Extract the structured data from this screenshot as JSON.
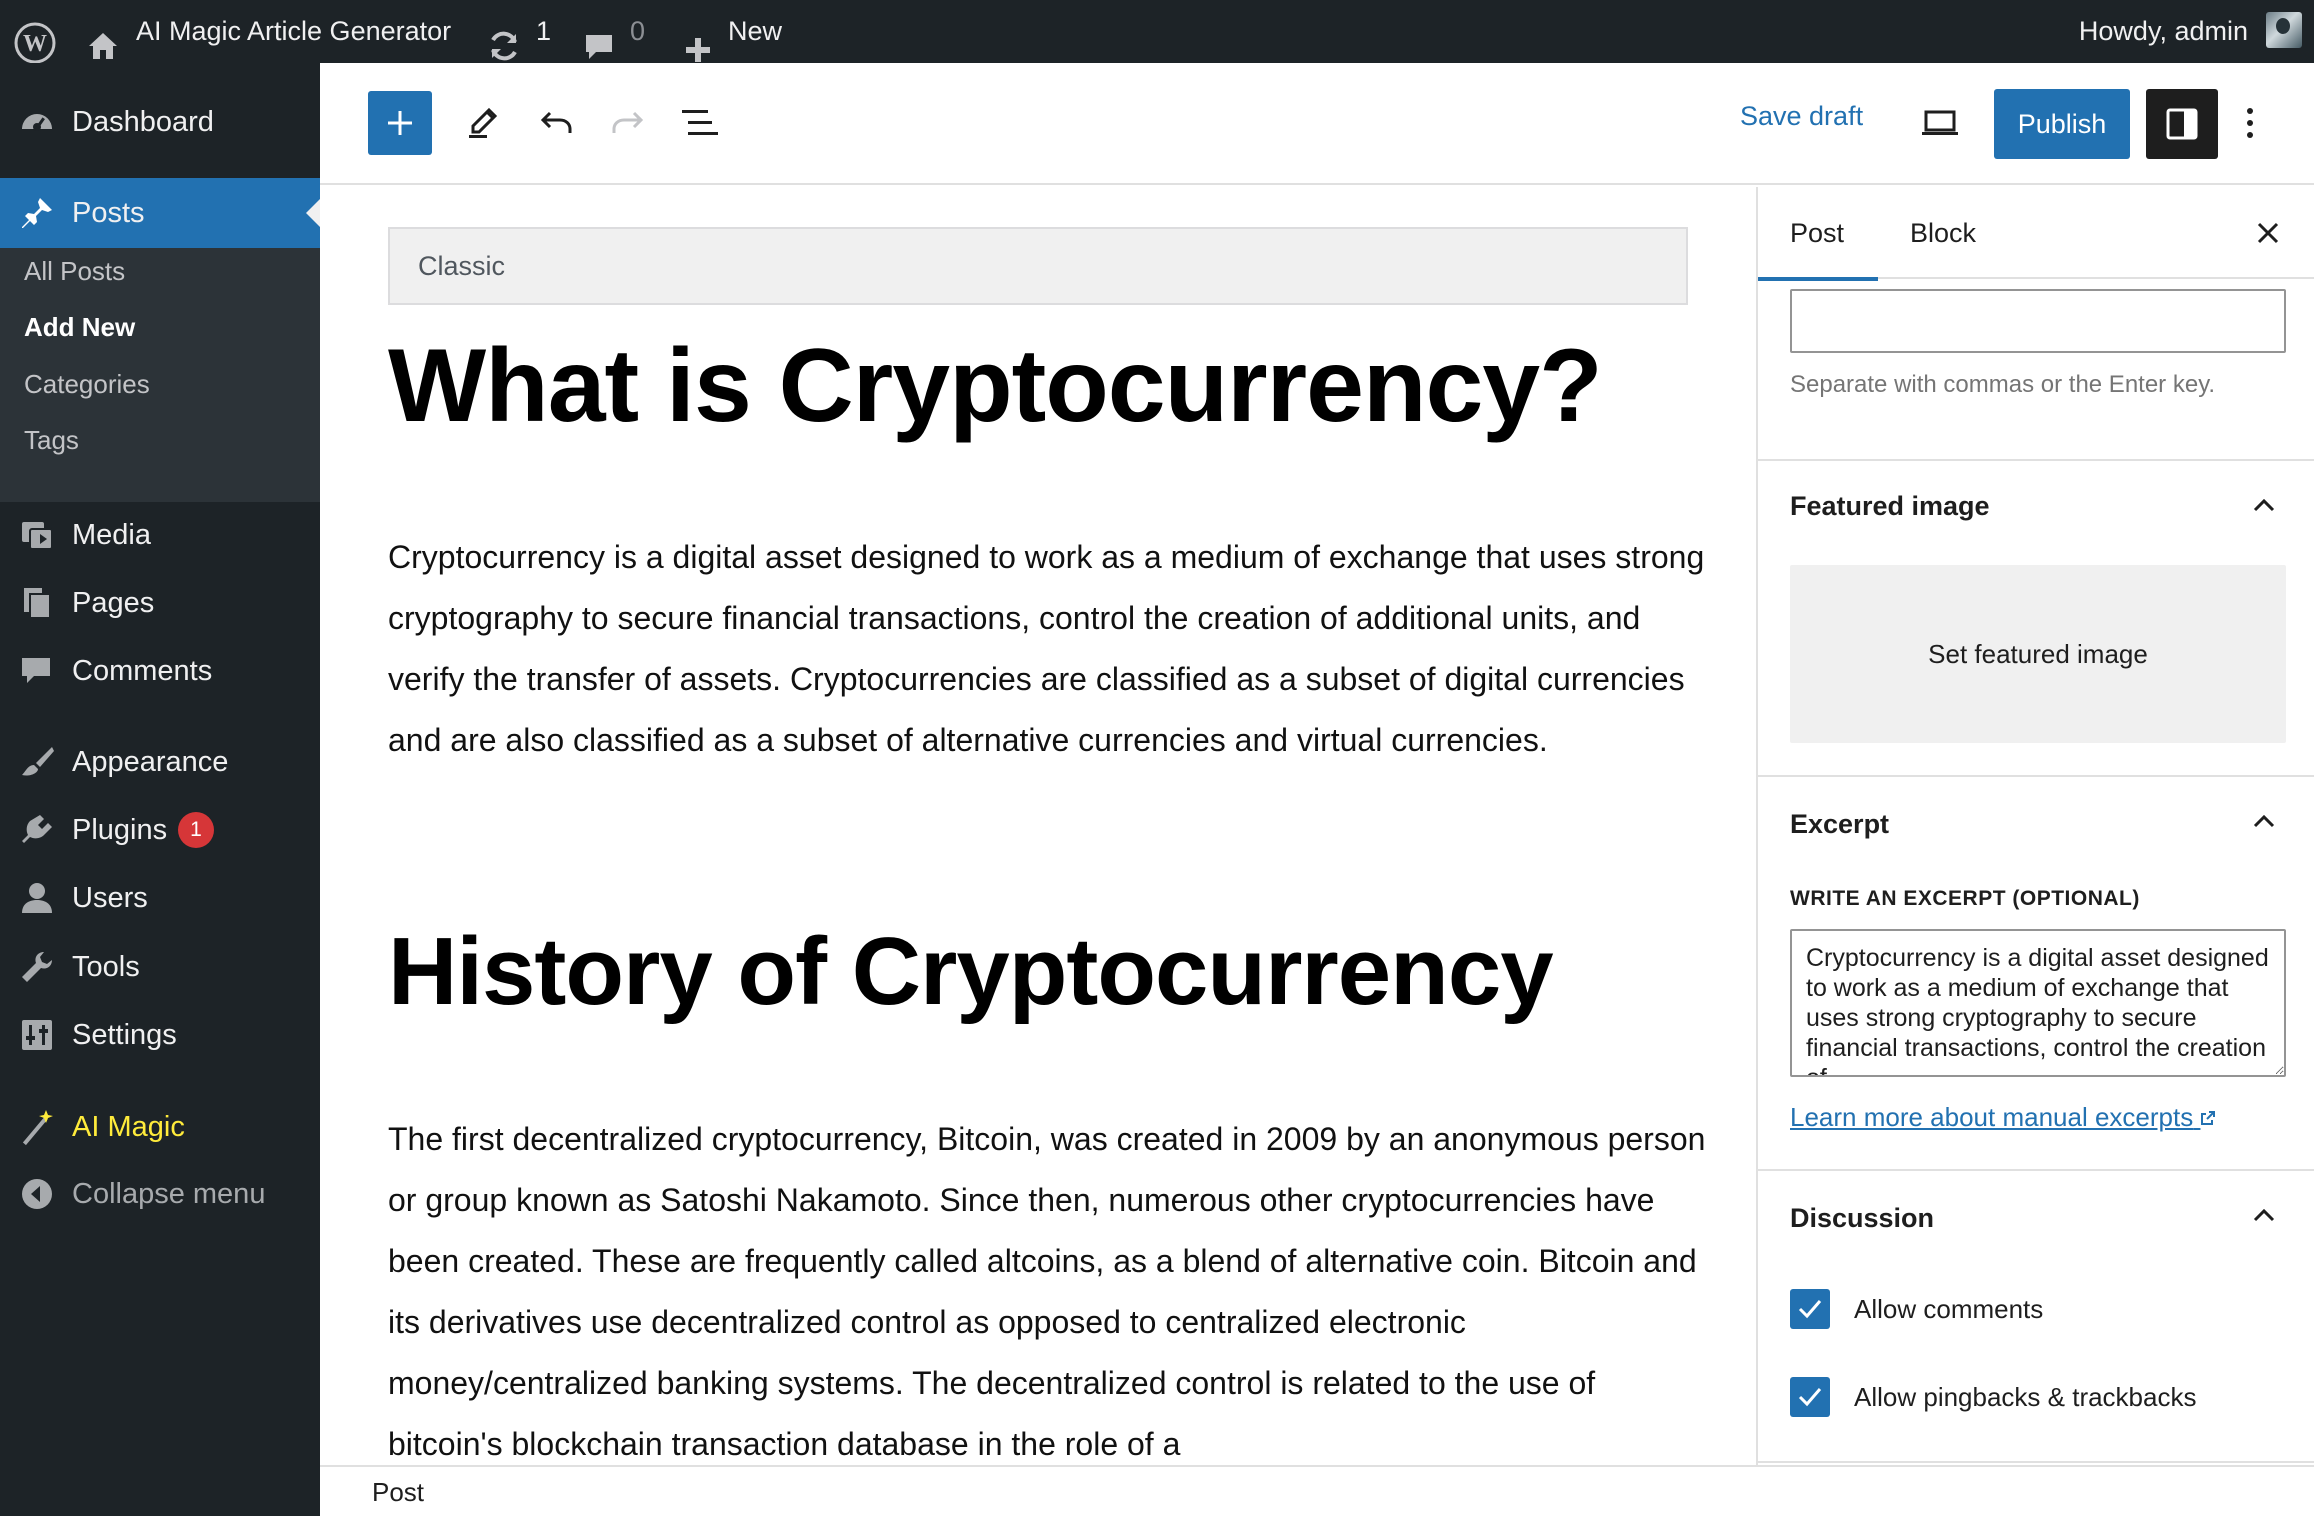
{
  "adminbar": {
    "site_name": "AI Magic Article Generator",
    "updates_count": "1",
    "comments_count": "0",
    "new_label": "New",
    "howdy": "Howdy, admin"
  },
  "sidebar": {
    "items": [
      {
        "label": "Dashboard",
        "icon": "dashboard-icon"
      },
      {
        "label": "Posts",
        "icon": "pin-icon"
      },
      {
        "label": "Media",
        "icon": "media-icon"
      },
      {
        "label": "Pages",
        "icon": "pages-icon"
      },
      {
        "label": "Comments",
        "icon": "comments-icon"
      },
      {
        "label": "Appearance",
        "icon": "brush-icon"
      },
      {
        "label": "Plugins",
        "icon": "plugin-icon",
        "badge": "1"
      },
      {
        "label": "Users",
        "icon": "users-icon"
      },
      {
        "label": "Tools",
        "icon": "wrench-icon"
      },
      {
        "label": "Settings",
        "icon": "settings-icon"
      },
      {
        "label": "AI Magic",
        "icon": "magic-wand-icon"
      },
      {
        "label": "Collapse menu",
        "icon": "collapse-icon"
      }
    ],
    "submenu": [
      "All Posts",
      "Add New",
      "Categories",
      "Tags"
    ],
    "current_submenu": "Add New",
    "accent_color": "#2271b1",
    "ai_magic_color": "#ffeb3b"
  },
  "toolbar": {
    "save_draft": "Save draft",
    "publish": "Publish"
  },
  "content": {
    "classic_label": "Classic",
    "heading1": "What is Cryptocurrency?",
    "para1": "Cryptocurrency is a digital asset designed to work as a medium of exchange that uses strong cryptography to secure financial transactions, control the creation of additional units, and verify the transfer of assets. Cryptocurrencies are classified as a subset of digital currencies and are also classified as a subset of alternative currencies and virtual currencies.",
    "heading2": "History of Cryptocurrency",
    "para2": "The first decentralized cryptocurrency, Bitcoin, was created in 2009 by an anonymous person or group known as Satoshi Nakamoto. Since then, numerous other cryptocurrencies have been created. These are frequently called altcoins, as a blend of alternative coin. Bitcoin and its derivatives use decentralized control as opposed to centralized electronic money/centralized banking systems. The decentralized control is related to the use of bitcoin's blockchain transaction database in the role of a"
  },
  "footer": {
    "breadcrumb": "Post"
  },
  "settings_panel": {
    "tabs": [
      "Post",
      "Block"
    ],
    "active_tab": "Post",
    "tags_help": "Separate with commas or the Enter key.",
    "featured_image": {
      "title": "Featured image",
      "button": "Set featured image"
    },
    "excerpt": {
      "title": "Excerpt",
      "label": "WRITE AN EXCERPT (OPTIONAL)",
      "value": "Cryptocurrency is a digital asset designed to work as a medium of exchange that uses strong cryptography to secure financial transactions, control the creation of",
      "link": "Learn more about manual excerpts"
    },
    "discussion": {
      "title": "Discussion",
      "options": [
        {
          "label": "Allow comments",
          "checked": true
        },
        {
          "label": "Allow pingbacks & trackbacks",
          "checked": true
        }
      ]
    }
  }
}
